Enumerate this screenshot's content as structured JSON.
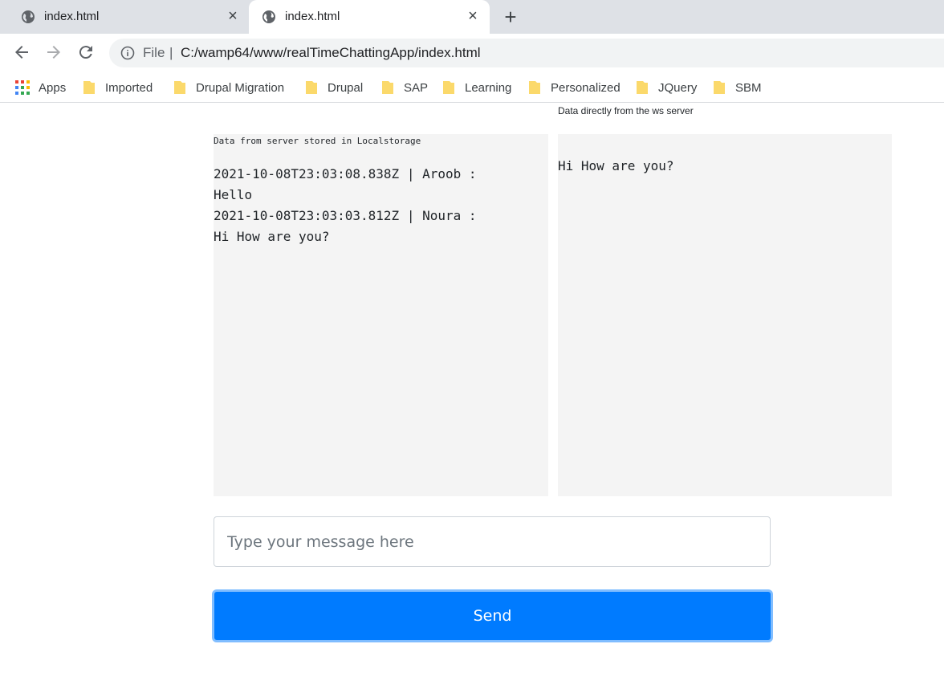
{
  "browser": {
    "tabs": [
      {
        "title": "index.html"
      },
      {
        "title": "index.html"
      }
    ],
    "address": {
      "scheme": "File",
      "separator": "|",
      "url": "C:/wamp64/www/realTimeChattingApp/index.html"
    },
    "bookmarks": {
      "apps": "Apps",
      "items": [
        "Imported",
        "Drupal Migration",
        "Drupal",
        "SAP",
        "Learning",
        "Personalized",
        "JQuery",
        "SBM"
      ]
    }
  },
  "page": {
    "ws_label": "Data directly from the ws server",
    "local_panel": {
      "title": "Data from server stored in Localstorage",
      "lines": [
        "2021-10-08T23:03:08.838Z | Aroob :",
        "Hello",
        "2021-10-08T23:03:03.812Z | Noura :",
        "Hi How are you?"
      ]
    },
    "ws_panel": {
      "lines": [
        "Hi How are you?"
      ]
    },
    "input": {
      "placeholder": "Type your message here",
      "value": ""
    },
    "send_label": "Send"
  },
  "colors": {
    "primary": "#007bff",
    "panel_bg": "#f4f4f4",
    "tabstrip_bg": "#dee1e6"
  }
}
